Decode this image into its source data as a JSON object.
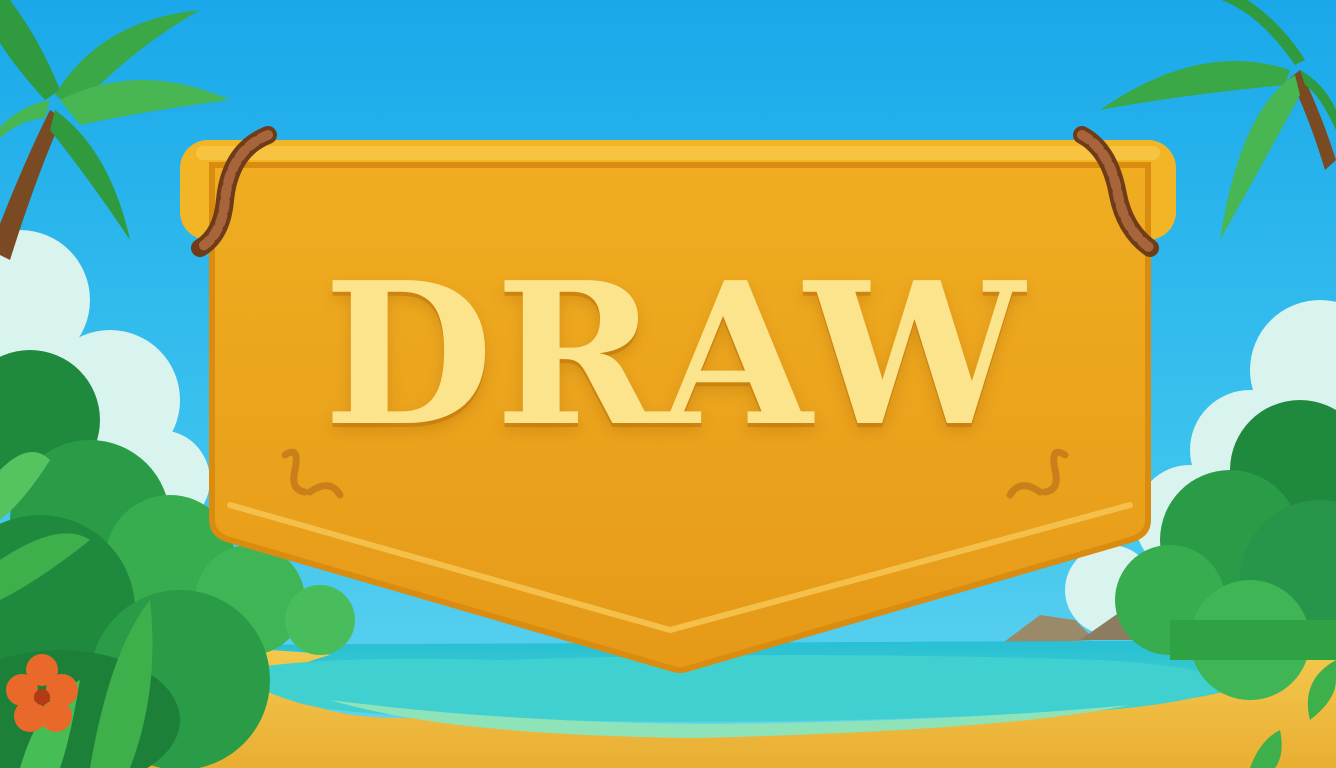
{
  "scene": {
    "name": "tropical-beach-result-screen",
    "banner": {
      "title": "DRAW",
      "fill_color": "#eea81f",
      "edge_color": "#d98c10",
      "text_color": "#fbe48c",
      "rope_color": "#9a5a2a"
    },
    "colors": {
      "sky": "#2bb5ec",
      "sea": "#3ccbd6",
      "sand": "#f0c24a",
      "foliage": "#2fa244",
      "flower": "#e8692a"
    }
  }
}
